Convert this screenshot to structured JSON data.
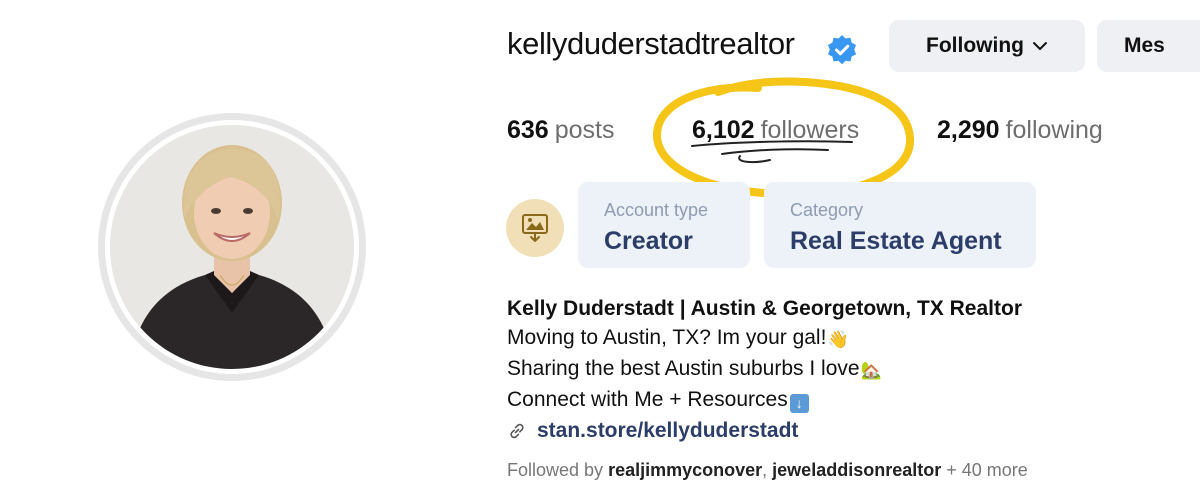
{
  "profile": {
    "username": "kellyduderstadtrealtor",
    "verified_icon": "verified-badge-icon",
    "buttons": {
      "following_label": "Following",
      "message_label": "Mes"
    },
    "stats": {
      "posts_count": "636",
      "posts_label": "posts",
      "followers_count": "6,102",
      "followers_label": "followers",
      "following_count": "2,290",
      "following_label": "following"
    },
    "professional": {
      "icon": "creator-dashboard-icon",
      "account_type_label": "Account type",
      "account_type_value": "Creator",
      "category_label": "Category",
      "category_value": "Real Estate Agent"
    },
    "bio": {
      "name": "Kelly Duderstadt | Austin & Georgetown, TX Realtor",
      "line1": "Moving to Austin, TX? Im your gal!",
      "line2": "Sharing the best Austin suburbs I love",
      "line3": "Connect with Me + Resources",
      "link": "stan.store/kellyduderstadt"
    },
    "followed_by": {
      "prefix": "Followed by",
      "user1": "realjimmyconover",
      "separator": ",",
      "user2": "jeweladdisonrealtor",
      "suffix": "+ 40 more"
    }
  },
  "colors": {
    "accent_blue": "#3897f0",
    "highlight_yellow": "#f5c518",
    "chip_bg": "#edf2f8",
    "chip_text": "#2b3d68",
    "button_bg": "#eff0f3"
  }
}
